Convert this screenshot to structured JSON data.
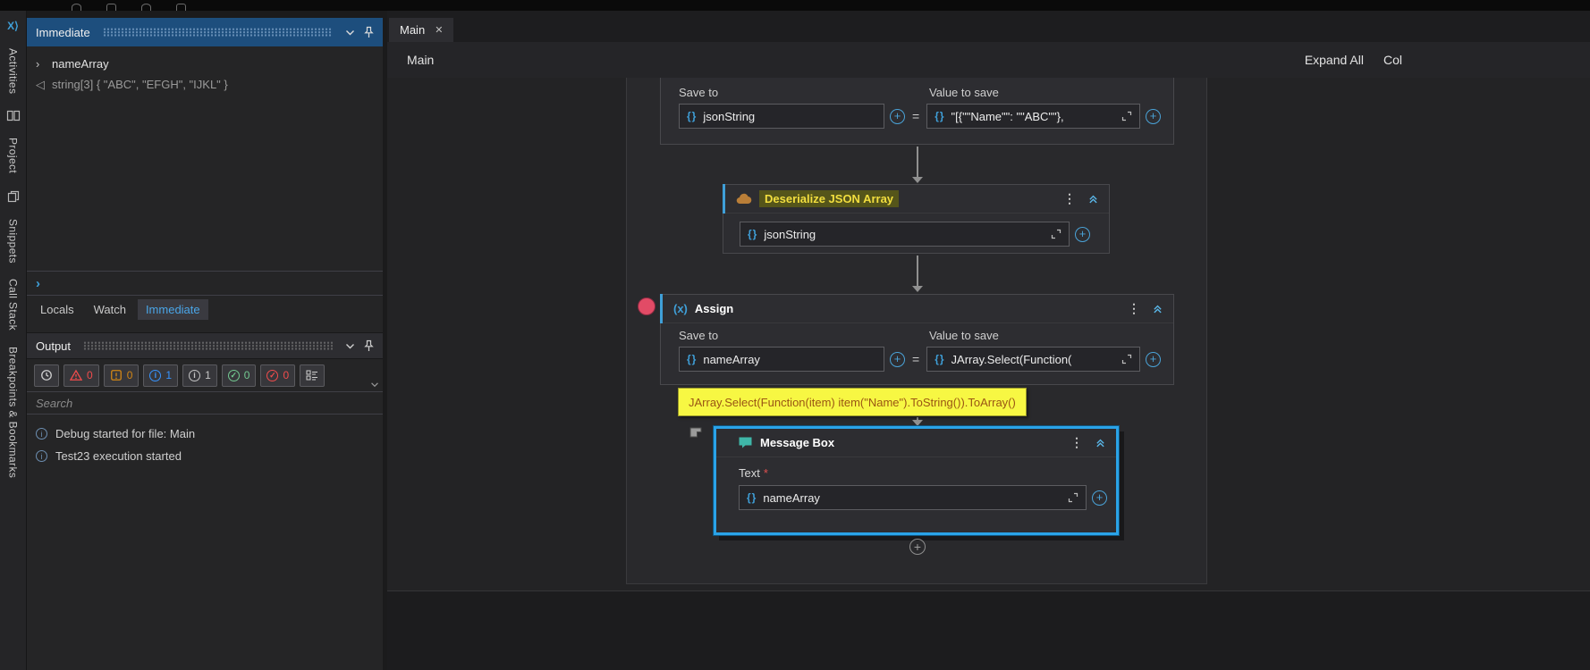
{
  "glyphs": {
    "info": "i",
    "check": "✓",
    "kebab": "⋮",
    "plus": "+",
    "braces": "{}",
    "close": "✕",
    "equals": "="
  },
  "colors": {
    "accent_blue": "#3f9fd8",
    "selection_blue": "#2aa3e8",
    "breakpoint_red": "#e24b66",
    "tooltip_bg": "#f7f743",
    "tooltip_text": "#9a5514",
    "title_highlight_bg": "#55551a",
    "title_highlight_text": "#f2de3f",
    "error_red": "#f14c4c",
    "warning_orange": "#d18616",
    "info_blue": "#3794ff",
    "trace_gray": "#c5c5c5",
    "success_green": "#73c991"
  },
  "activity_bar": {
    "file_badge": "X⟩",
    "items": [
      {
        "label": "Activities"
      },
      {
        "label": "Project"
      },
      {
        "label": "Snippets"
      },
      {
        "label": "Call Stack"
      },
      {
        "label": "Breakpoints & Bookmarks"
      }
    ]
  },
  "immediate": {
    "title": "Immediate",
    "rows": [
      {
        "prefix": "›",
        "text": "nameArray"
      },
      {
        "prefix": "◁",
        "text": "string[3] { \"ABC\", \"EFGH\", \"IJKL\" }"
      }
    ],
    "prompt": "›",
    "tabs": [
      {
        "label": "Locals"
      },
      {
        "label": "Watch"
      },
      {
        "label": "Immediate"
      }
    ]
  },
  "output": {
    "title": "Output",
    "counters": [
      {
        "name": "errors",
        "count": "0",
        "color": "#f14c4c"
      },
      {
        "name": "warnings",
        "count": "0",
        "color": "#d18616"
      },
      {
        "name": "info",
        "count": "1",
        "color": "#3794ff"
      },
      {
        "name": "trace",
        "count": "1",
        "color": "#c5c5c5"
      },
      {
        "name": "success",
        "count": "0",
        "color": "#73c991"
      },
      {
        "name": "verified",
        "count": "0",
        "color": "#f14c4c"
      }
    ],
    "search_placeholder": "Search",
    "logs": [
      {
        "text": "Debug started for file: Main"
      },
      {
        "text": "Test23 execution started"
      }
    ]
  },
  "main": {
    "tab_label": "Main",
    "breadcrumb": "Main",
    "expand_all": "Expand All",
    "collapse_all": "Col"
  },
  "workflow": {
    "assign_top": {
      "save_to": "Save to",
      "value_to_save": "Value to save",
      "target": "jsonString",
      "value": "\"[{\"\"Name\"\": \"\"ABC\"\"},"
    },
    "deserialize": {
      "title": "Deserialize JSON Array",
      "input": "jsonString"
    },
    "assign": {
      "icon": "(x)",
      "title": "Assign",
      "save_to": "Save to",
      "value_to_save": "Value to save",
      "target": "nameArray",
      "value": "JArray.Select(Function("
    },
    "tooltip": "JArray.Select(Function(item) item(\"Name\").ToString()).ToArray()",
    "message_box": {
      "title": "Message Box",
      "text_label": "Text",
      "required_mark": "*",
      "value": "nameArray"
    }
  }
}
